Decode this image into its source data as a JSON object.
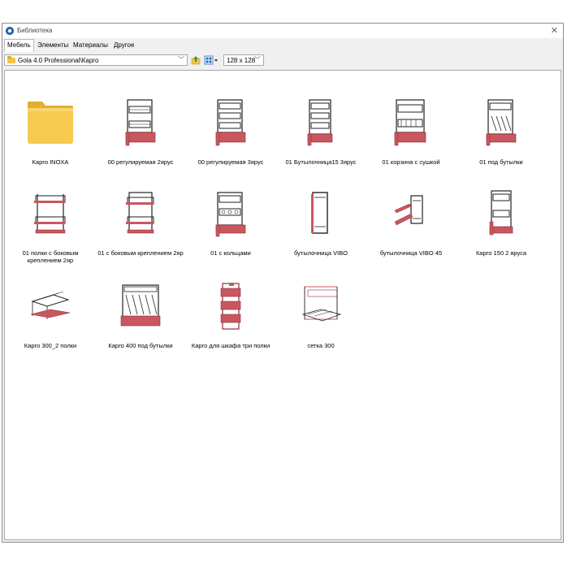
{
  "window": {
    "title": "Библиотека",
    "close_glyph": "✕",
    "app_icon": "app-logo-icon"
  },
  "tabs": [
    {
      "label": "Мебель",
      "active": true
    },
    {
      "label": "Элементы",
      "active": false
    },
    {
      "label": "Материалы",
      "active": false
    },
    {
      "label": "Другое",
      "active": false
    }
  ],
  "toolbar": {
    "path": "Gola 4.0 Professional\\Карго",
    "path_arrow": "﹀",
    "size": "128 x 128",
    "size_arrow": "﹀"
  },
  "colors": {
    "accent_red": "#c9575f",
    "wire": "#222222",
    "folder": "#f3c34b"
  },
  "items": [
    {
      "label": "Карго INOXA",
      "icon": "folder-icon"
    },
    {
      "label": "00 регулируемая 2ярус",
      "icon": "cargo-basket-icon"
    },
    {
      "label": "00 регулируемая 3ярус",
      "icon": "cargo-basket-icon"
    },
    {
      "label": "01 Бутылочница15 3ярус",
      "icon": "cargo-basket-icon"
    },
    {
      "label": "01 корзина с сушкой",
      "icon": "cargo-basket-icon"
    },
    {
      "label": "01 под бутылки",
      "icon": "cargo-basket-icon"
    },
    {
      "label": "01 полки с боковым креплением 2яр",
      "icon": "cargo-basket-icon"
    },
    {
      "label": "01 с боковым креплением 2яр",
      "icon": "cargo-basket-icon"
    },
    {
      "label": "01 с кольцами",
      "icon": "cargo-basket-icon"
    },
    {
      "label": "бутылочница VIBO",
      "icon": "cargo-basket-icon"
    },
    {
      "label": "бутылочница VIBO 45",
      "icon": "cargo-basket-icon"
    },
    {
      "label": "Карго 150 2 яруса",
      "icon": "cargo-basket-icon"
    },
    {
      "label": "Карго 300_2 полки",
      "icon": "cargo-basket-icon"
    },
    {
      "label": "Карго 400 под бутылки",
      "icon": "cargo-basket-icon"
    },
    {
      "label": "Карго для шкафа три полки",
      "icon": "cargo-basket-icon"
    },
    {
      "label": "сетка 300",
      "icon": "cargo-basket-icon"
    }
  ]
}
